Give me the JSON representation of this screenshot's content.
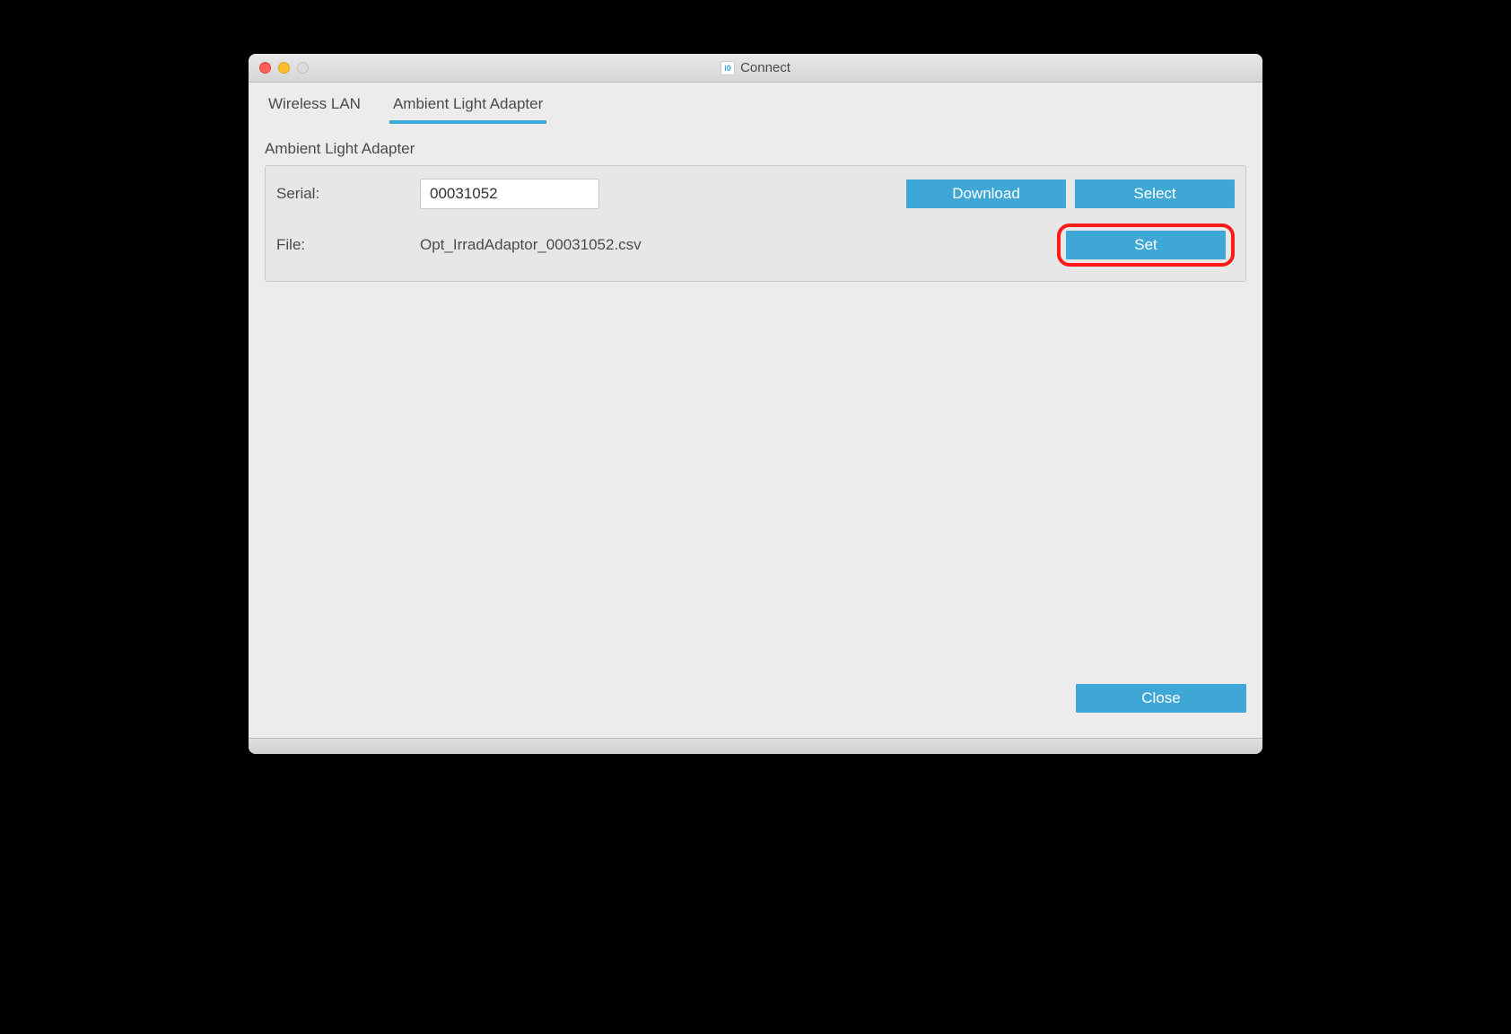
{
  "window": {
    "title": "Connect",
    "app_icon_text": "i0"
  },
  "tabs": {
    "wireless_lan": "Wireless LAN",
    "ambient_light_adapter": "Ambient Light Adapter",
    "active": "ambient_light_adapter"
  },
  "section": {
    "title": "Ambient Light Adapter"
  },
  "form": {
    "serial_label": "Serial:",
    "serial_value": "00031052",
    "file_label": "File:",
    "file_value": "Opt_IrradAdaptor_00031052.csv"
  },
  "buttons": {
    "download": "Download",
    "select": "Select",
    "set": "Set",
    "close": "Close"
  },
  "colors": {
    "accent": "#3fa7d6",
    "highlight": "#ff1a1a"
  }
}
